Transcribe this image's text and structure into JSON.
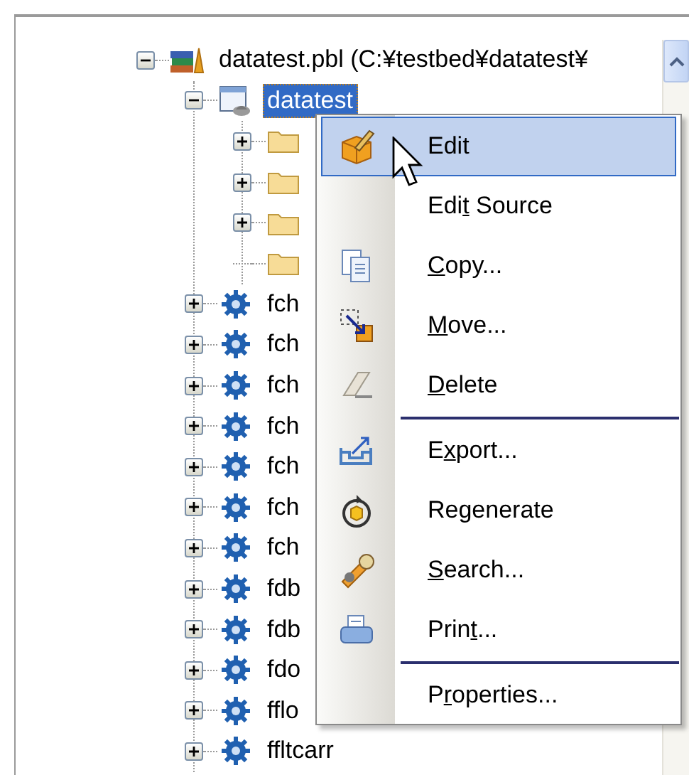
{
  "tree": [
    {
      "label": "datatest.pbl (C:¥testbed¥datatest¥",
      "kind": "library",
      "expandable": true,
      "expanded": true,
      "selected": false,
      "children": [
        {
          "label": "datatest",
          "kind": "application",
          "expandable": true,
          "expanded": true,
          "selected": true,
          "children": [
            {
              "kind": "folder",
              "expandable": true,
              "expanded": false
            },
            {
              "kind": "folder",
              "expandable": true,
              "expanded": false
            },
            {
              "kind": "folder",
              "expandable": true,
              "expanded": false
            },
            {
              "kind": "folder",
              "expandable": false
            }
          ]
        },
        {
          "label": "fch",
          "kind": "object",
          "expandable": true,
          "expanded": false,
          "selected": false
        },
        {
          "label": "fch",
          "kind": "object",
          "expandable": true,
          "expanded": false,
          "selected": false
        },
        {
          "label": "fch",
          "kind": "object",
          "expandable": true,
          "expanded": false,
          "selected": false
        },
        {
          "label": "fch",
          "kind": "object",
          "expandable": true,
          "expanded": false,
          "selected": false
        },
        {
          "label": "fch",
          "kind": "object",
          "expandable": true,
          "expanded": false,
          "selected": false
        },
        {
          "label": "fch",
          "kind": "object",
          "expandable": true,
          "expanded": false,
          "selected": false
        },
        {
          "label": "fch",
          "kind": "object",
          "expandable": true,
          "expanded": false,
          "selected": false
        },
        {
          "label": "fdb",
          "kind": "object",
          "expandable": true,
          "expanded": false,
          "selected": false
        },
        {
          "label": "fdb",
          "kind": "object",
          "expandable": true,
          "expanded": false,
          "selected": false
        },
        {
          "label": "fdo",
          "kind": "object",
          "expandable": true,
          "expanded": false,
          "selected": false
        },
        {
          "label": "fflo",
          "kind": "object",
          "expandable": true,
          "expanded": false,
          "selected": false
        },
        {
          "label": "ffltcarr",
          "kind": "object",
          "expandable": true,
          "expanded": false,
          "selected": false
        }
      ]
    }
  ],
  "context_menu": [
    {
      "kind": "item",
      "label": "Edit",
      "selected": true
    },
    {
      "kind": "item",
      "pre": "Edi",
      "key": "t",
      "post": " Source",
      "selected": false
    },
    {
      "kind": "item",
      "key": "C",
      "post": "opy...",
      "selected": false
    },
    {
      "kind": "item",
      "key": "M",
      "post": "ove...",
      "selected": false
    },
    {
      "kind": "item",
      "key": "D",
      "post": "elete",
      "selected": false
    },
    {
      "kind": "separator"
    },
    {
      "kind": "item",
      "pre": "E",
      "key": "x",
      "post": "port...",
      "selected": false
    },
    {
      "kind": "item",
      "label": "Regenerate",
      "selected": false
    },
    {
      "kind": "item",
      "key": "S",
      "post": "earch...",
      "selected": false
    },
    {
      "kind": "item",
      "pre": "Prin",
      "key": "t",
      "post": "...",
      "selected": false
    },
    {
      "kind": "separator"
    },
    {
      "kind": "item",
      "pre": "P",
      "key": "r",
      "post": "operties...",
      "selected": false
    }
  ]
}
